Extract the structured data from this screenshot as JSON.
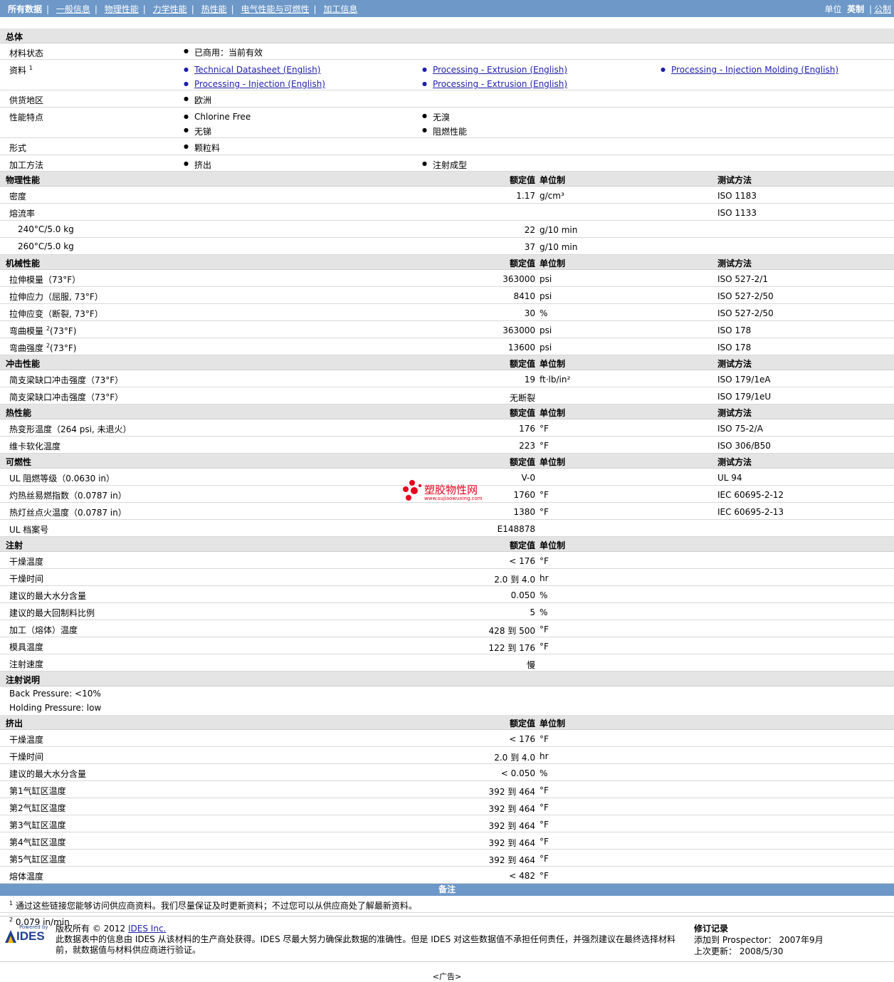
{
  "nav": {
    "items": [
      "所有数据",
      "一般信息",
      "物理性能",
      "力学性能",
      "热性能",
      "电气性能与可燃性",
      "加工信息"
    ],
    "unit_label": "单位",
    "unit_english": "英制",
    "unit_metric": "公制"
  },
  "cols": {
    "value": "额定值",
    "unit": "单位制",
    "method": "测试方法"
  },
  "general": {
    "title": "总体",
    "status_label": "材料状态",
    "status_value": "已商用：当前有效",
    "docs_label": "资料",
    "docs_sup": "1",
    "docs": [
      "Technical Datasheet (English)",
      "Processing - Extrusion (English)",
      "Processing - Injection Molding (English)",
      "Processing - Injection (English)",
      "Processing - Extrusion (English)"
    ],
    "region_label": "供货地区",
    "region_value": "欧洲",
    "features_label": "性能特点",
    "features": [
      "Chlorine Free",
      "无溴",
      "无锑",
      "阻燃性能"
    ],
    "form_label": "形式",
    "form_value": "颗粒料",
    "method_label": "加工方法",
    "methods": [
      "挤出",
      "注射成型"
    ]
  },
  "physical": {
    "title": "物理性能",
    "rows": [
      {
        "label": "密度",
        "value": "1.17",
        "unit": "g/cm³",
        "method": "ISO 1183"
      },
      {
        "label": "熔流率",
        "value": "",
        "unit": "",
        "method": "ISO 1133"
      },
      {
        "label": "240°C/5.0 kg",
        "value": "22",
        "unit": "g/10 min",
        "method": "",
        "indent": true
      },
      {
        "label": "260°C/5.0 kg",
        "value": "37",
        "unit": "g/10 min",
        "method": "",
        "indent": true
      }
    ]
  },
  "mechanical": {
    "title": "机械性能",
    "rows": [
      {
        "label": "拉伸模量（73°F）",
        "value": "363000",
        "unit": "psi",
        "method": "ISO 527-2/1"
      },
      {
        "label": "拉伸应力（屈服, 73°F）",
        "value": "8410",
        "unit": "psi",
        "method": "ISO 527-2/50"
      },
      {
        "label": "拉伸应变（断裂, 73°F）",
        "value": "30",
        "unit": "%",
        "method": "ISO 527-2/50"
      },
      {
        "label": "弯曲模量",
        "sup": "2",
        "label2": "(73°F)",
        "value": "363000",
        "unit": "psi",
        "method": "ISO 178"
      },
      {
        "label": "弯曲强度",
        "sup": "2",
        "label2": "(73°F)",
        "value": "13600",
        "unit": "psi",
        "method": "ISO 178"
      }
    ]
  },
  "impact": {
    "title": "冲击性能",
    "rows": [
      {
        "label": "简支梁缺口冲击强度（73°F）",
        "value": "19",
        "unit": "ft·lb/in²",
        "method": "ISO 179/1eA"
      },
      {
        "label": "简支梁缺口冲击强度（73°F）",
        "value": "无断裂",
        "unit": "",
        "method": "ISO 179/1eU"
      }
    ]
  },
  "thermal": {
    "title": "热性能",
    "rows": [
      {
        "label": "热变形温度（264 psi, 未退火）",
        "value": "176",
        "unit": "°F",
        "method": "ISO 75-2/A"
      },
      {
        "label": "维卡软化温度",
        "value": "223",
        "unit": "°F",
        "method": "ISO 306/B50"
      }
    ]
  },
  "flammability": {
    "title": "可燃性",
    "rows": [
      {
        "label": "UL 阻燃等级（0.0630 in）",
        "value": "V-0",
        "unit": "",
        "method": "UL 94"
      },
      {
        "label": "灼热丝易燃指数（0.0787 in）",
        "value": "1760",
        "unit": "°F",
        "method": "IEC 60695-2-12"
      },
      {
        "label": "热灯丝点火温度（0.0787 in）",
        "value": "1380",
        "unit": "°F",
        "method": "IEC 60695-2-13"
      },
      {
        "label": "UL 档案号",
        "value": "E148878",
        "unit": "",
        "method": ""
      }
    ]
  },
  "injection": {
    "title": "注射",
    "rows": [
      {
        "label": "干燥温度",
        "value": "< 176",
        "unit": "°F"
      },
      {
        "label": "干燥时间",
        "value": "2.0 到  4.0",
        "unit": "hr"
      },
      {
        "label": "建议的最大水分含量",
        "value": "0.050",
        "unit": "%"
      },
      {
        "label": "建议的最大回制料比例",
        "value": "5",
        "unit": "%"
      },
      {
        "label": "加工（熔体）温度",
        "value": "428 到  500",
        "unit": "°F"
      },
      {
        "label": "模具温度",
        "value": "122 到  176",
        "unit": "°F"
      },
      {
        "label": "注射速度",
        "value": "慢",
        "unit": ""
      }
    ]
  },
  "injection_notes": {
    "title": "注射说明",
    "lines": [
      "Back Pressure: <10%",
      "Holding Pressure: low"
    ]
  },
  "extrusion": {
    "title": "挤出",
    "rows": [
      {
        "label": "干燥温度",
        "value": "< 176",
        "unit": "°F"
      },
      {
        "label": "干燥时间",
        "value": "2.0 到  4.0",
        "unit": "hr"
      },
      {
        "label": "建议的最大水分含量",
        "value": "< 0.050",
        "unit": "%"
      },
      {
        "label": "第1气缸区温度",
        "value": "392 到  464",
        "unit": "°F"
      },
      {
        "label": "第2气缸区温度",
        "value": "392 到  464",
        "unit": "°F"
      },
      {
        "label": "第3气缸区温度",
        "value": "392 到  464",
        "unit": "°F"
      },
      {
        "label": "第4气缸区温度",
        "value": "392 到  464",
        "unit": "°F"
      },
      {
        "label": "第5气缸区温度",
        "value": "392 到  464",
        "unit": "°F"
      },
      {
        "label": "熔体温度",
        "value": "< 482",
        "unit": "°F"
      }
    ]
  },
  "remarks": {
    "title": "备注",
    "n1_sup": "1",
    "n1": "通过这些链接您能够访问供应商资料。我们尽量保证及时更新资料；不过您可以从供应商处了解最新资料。",
    "n2_sup": "2",
    "n2": "0.079 in/min"
  },
  "watermark": {
    "name": "塑胶物性网",
    "url": "www.sujiaowuxing.com"
  },
  "footer": {
    "powered": "Powered by",
    "logo": "IDES",
    "copyright": "版权所有 © 2012",
    "company_link": "IDES Inc.",
    "disclaimer": "此数据表中的信息由 IDES 从该材料的生产商处获得。IDES 尽最大努力确保此数据的准确性。但是 IDES 对这些数据值不承担任何责任，并强烈建议在最终选择材料前，就数据值与材料供应商进行验证。",
    "rev_title": "修订记录",
    "added_label": "添加到 Prospector：",
    "added_value": "2007年9月",
    "updated_label": "上次更新：",
    "updated_value": "2008/5/30",
    "ad": "<广告>"
  },
  "colors": {
    "bar": "#6d98c8",
    "header_bg": "#e4e4e4",
    "link": "#1f1fa8",
    "watermark_red": "#e8001c"
  }
}
